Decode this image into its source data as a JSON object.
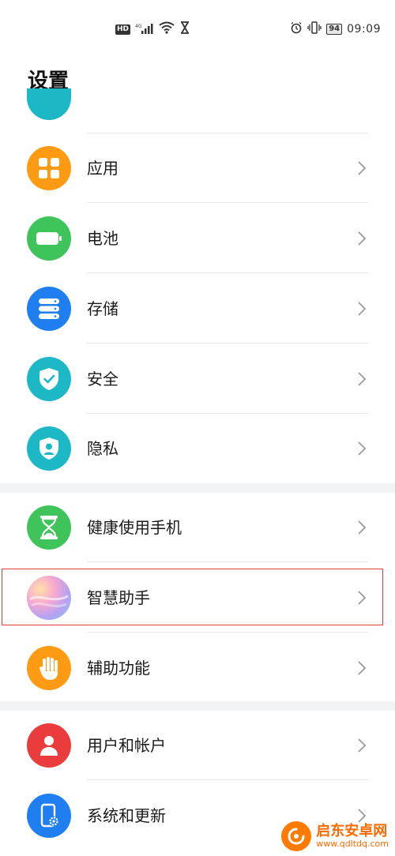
{
  "status_bar": {
    "hd_badge": "HD",
    "network": "4G",
    "battery": "94",
    "time": "09:09",
    "icons": [
      "hd-icon",
      "signal-icon",
      "wifi-icon",
      "hourglass-icon",
      "alarm-icon",
      "vibrate-icon",
      "battery-icon"
    ]
  },
  "header": {
    "title": "设置"
  },
  "sections": [
    {
      "items": [
        {
          "label": "应用",
          "icon": "apps-icon",
          "color": "#ff9b12"
        },
        {
          "label": "电池",
          "icon": "battery-icon",
          "color": "#3fc45b"
        },
        {
          "label": "存储",
          "icon": "storage-icon",
          "color": "#1f7ff0"
        },
        {
          "label": "安全",
          "icon": "shield-check-icon",
          "color": "#1cb8c6"
        },
        {
          "label": "隐私",
          "icon": "privacy-shield-icon",
          "color": "#1cb8c6"
        }
      ]
    },
    {
      "items": [
        {
          "label": "健康使用手机",
          "icon": "hourglass-icon",
          "color": "#3fc45b"
        },
        {
          "label": "智慧助手",
          "icon": "assistant-gradient-icon",
          "color": "#f3a6d2"
        },
        {
          "label": "辅助功能",
          "icon": "hand-icon",
          "color": "#ff9b12"
        }
      ]
    },
    {
      "items": [
        {
          "label": "用户和帐户",
          "icon": "user-icon",
          "color": "#ea3c3c"
        },
        {
          "label": "系统和更新",
          "icon": "phone-gear-icon",
          "color": "#1f7ff0"
        }
      ]
    }
  ],
  "watermark": {
    "title": "启东安卓网",
    "url": "www.qdltdq.com"
  }
}
